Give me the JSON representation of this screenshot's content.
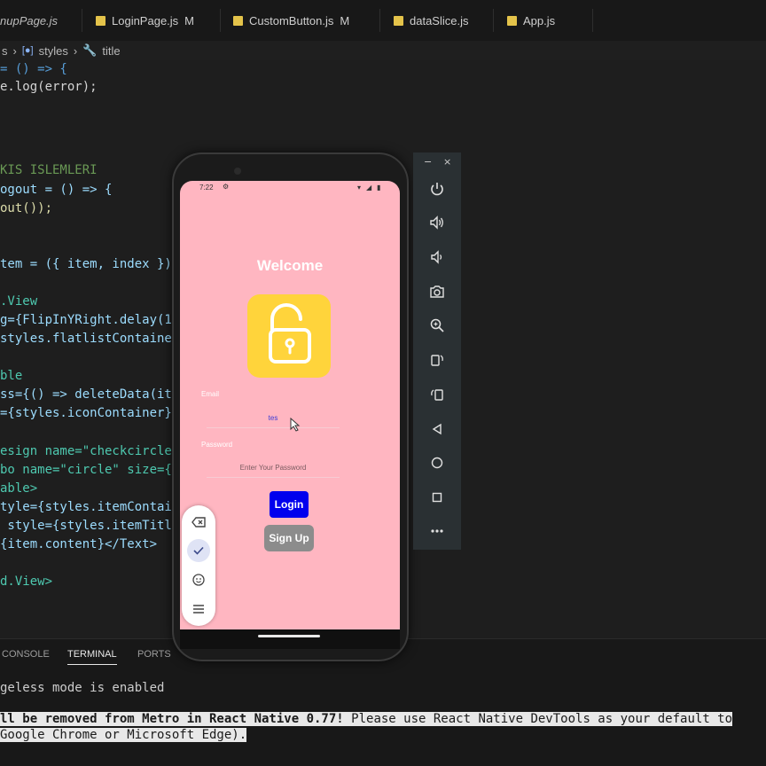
{
  "tabs": [
    {
      "label": "nupPage.js",
      "modified": ""
    },
    {
      "label": "LoginPage.js",
      "modified": "M"
    },
    {
      "label": "CustomButton.js",
      "modified": "M"
    },
    {
      "label": "dataSlice.js",
      "modified": ""
    },
    {
      "label": "App.js",
      "modified": ""
    }
  ],
  "breadcrumb": {
    "start": "s",
    "styles": "styles",
    "title": "title"
  },
  "code_lines": [
    "= () => {",
    "e.log(error);",
    "",
    "",
    "KIS ISLEMLERI",
    "ogout = () => {",
    "out());",
    "",
    "",
    "tem = ({ item, index })",
    "",
    ".View",
    "g={FlipInYRight.delay(1",
    "styles.flatlistContaine",
    "",
    "ble",
    "ss={() => deleteData(it",
    "={styles.iconContainer}",
    "",
    "esign name=\"checkcircle",
    "bo name=\"circle\" size={",
    "able>",
    "tyle={styles.itemContai",
    " style={styles.itemTitl",
    "{item.content}</Text>",
    "",
    "d.View>"
  ],
  "panel": {
    "tabs": [
      "CONSOLE",
      "TERMINAL",
      "PORTS"
    ],
    "active": "TERMINAL"
  },
  "terminal": {
    "line1": "geless mode is enabled",
    "line2a": "ll be removed from Metro in React Native 0.77!",
    "line2b": " Please use React Native DevTools as your default to",
    "line3": "Google Chrome or Microsoft Edge)."
  },
  "phone": {
    "time": "7:22",
    "welcome": "Welcome",
    "email_label": "Email",
    "email_value": "tes",
    "password_label": "Password",
    "password_placeholder": "Enter Your Password",
    "login_label": "Login",
    "signup_label": "Sign Up"
  },
  "emulator": {
    "minimize": "−",
    "close": "×",
    "buttons": [
      "power-icon",
      "volume-up-icon",
      "volume-down-icon",
      "camera-icon",
      "zoom-icon",
      "rotate-left-icon",
      "rotate-right-icon",
      "back-icon",
      "home-icon",
      "overview-icon",
      "more-icon"
    ]
  },
  "colors": {
    "phone_bg": "#ffb6c1",
    "lock_bg": "#ffd43b",
    "login_bg": "#0000ee",
    "signup_bg": "#8c8c8c"
  }
}
